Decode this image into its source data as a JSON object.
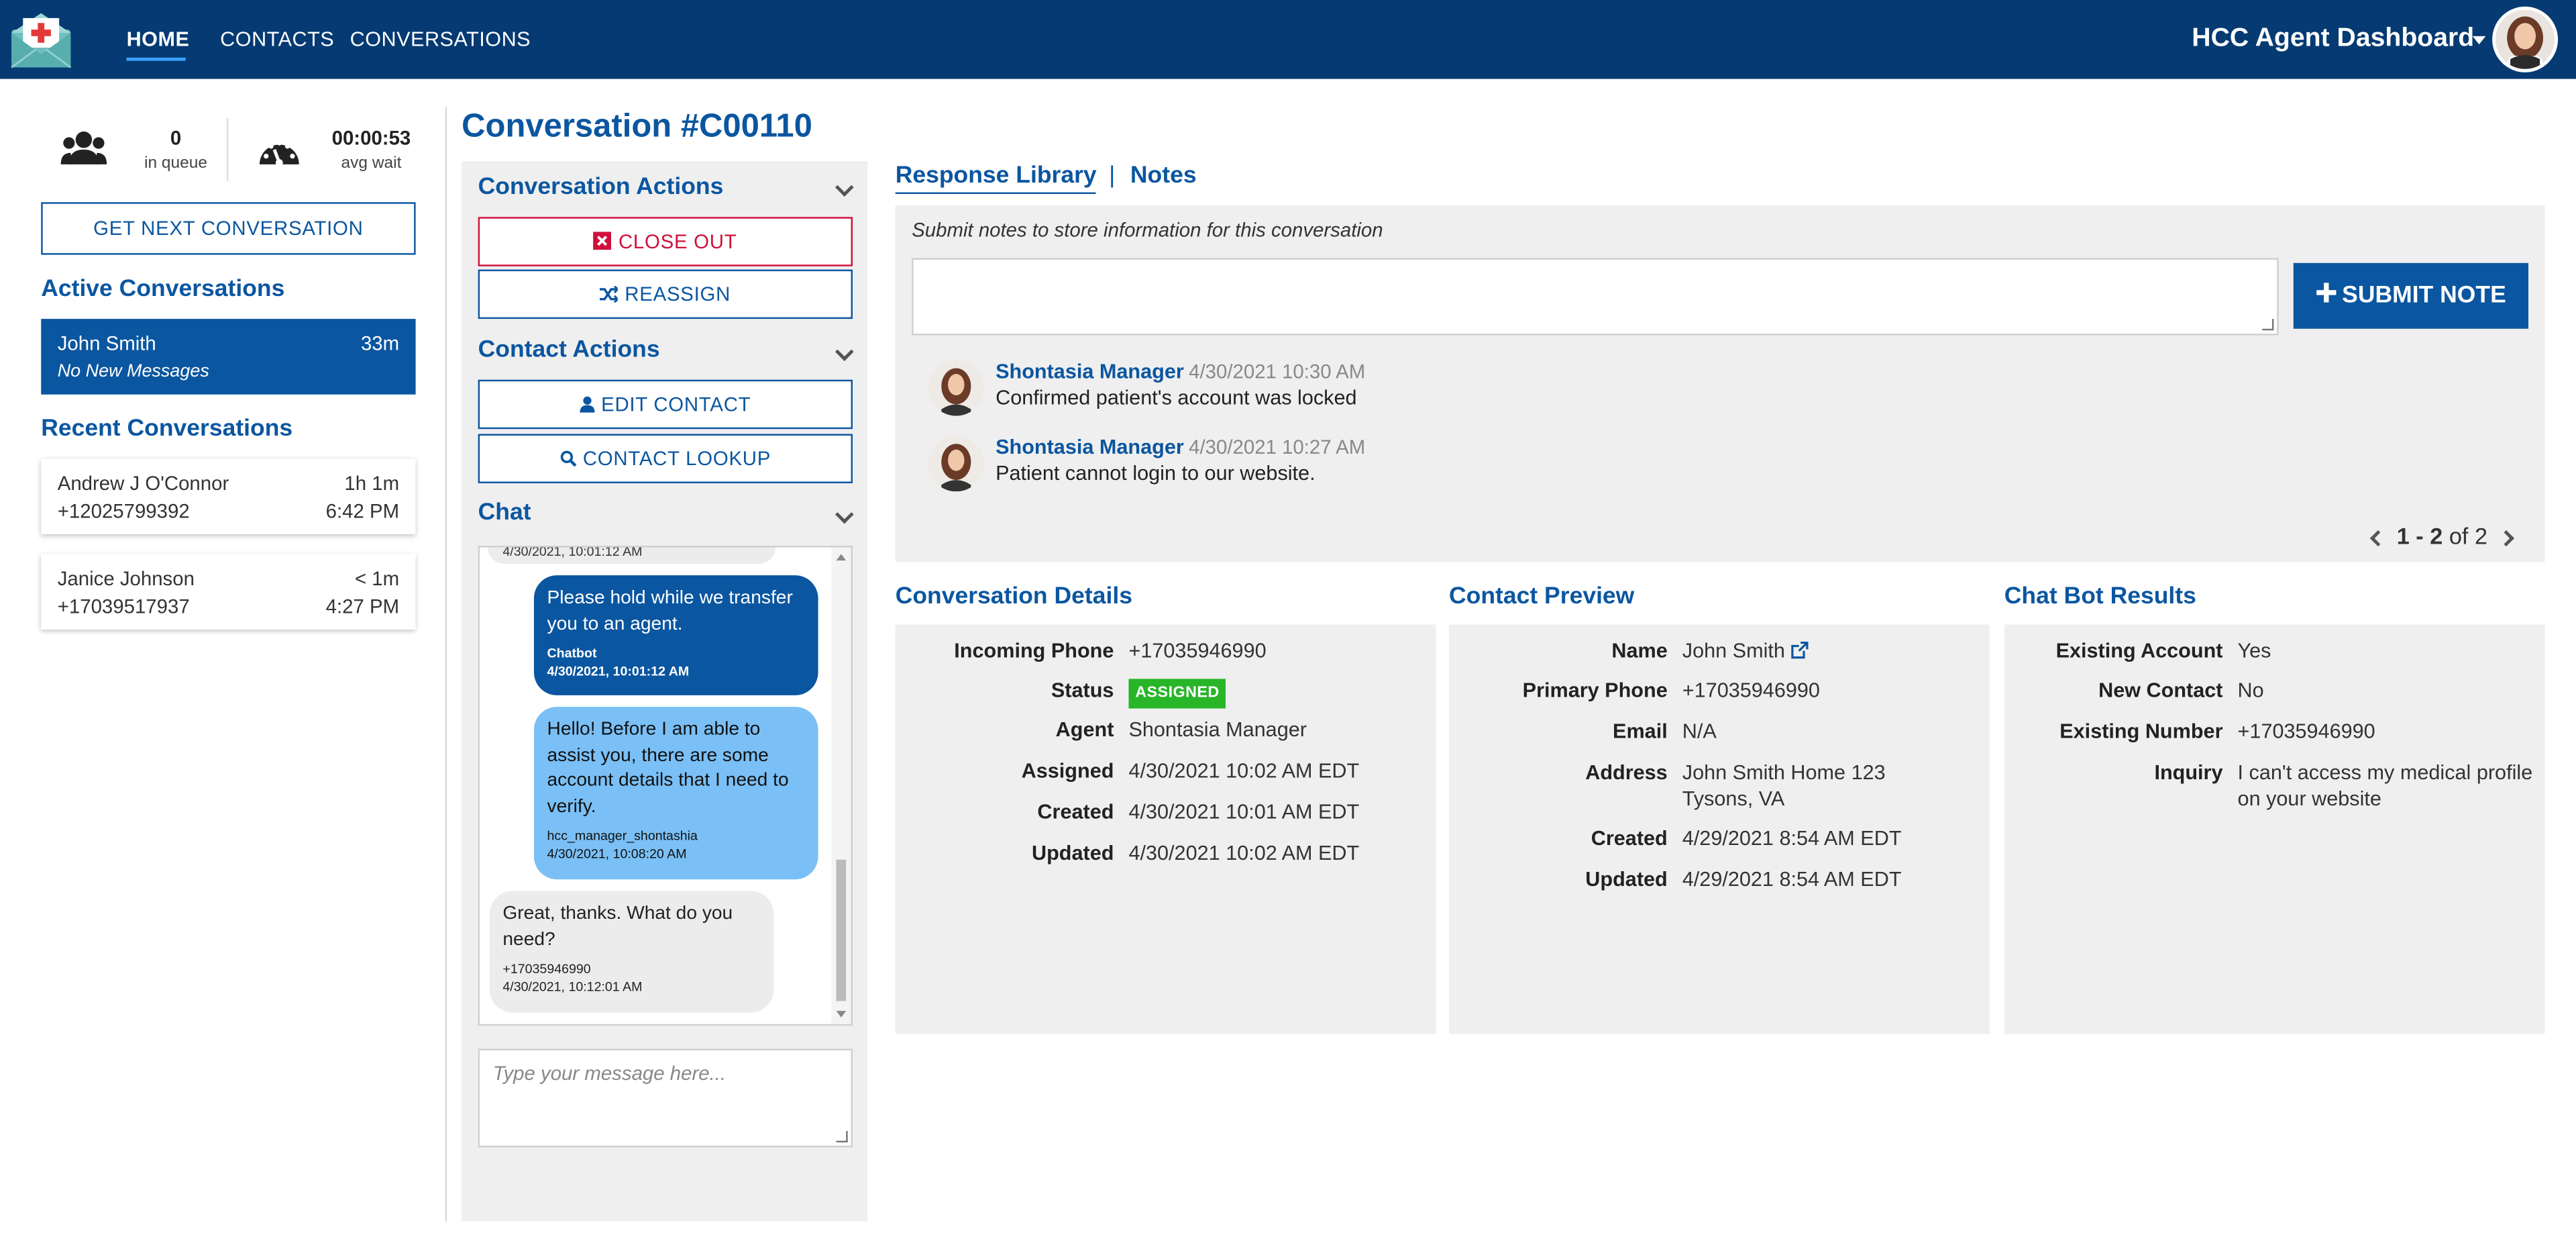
{
  "nav": {
    "links": [
      "HOME",
      "CONTACTS",
      "CONVERSATIONS"
    ],
    "dashboard_title": "HCC Agent Dashboard"
  },
  "stats": {
    "queue_value": "0",
    "queue_label": "in queue",
    "wait_value": "00:00:53",
    "wait_label": "avg wait"
  },
  "left": {
    "next_button": "GET NEXT CONVERSATION",
    "active_heading": "Active Conversations",
    "active": {
      "name": "John Smith",
      "time": "33m",
      "sub": "No New Messages"
    },
    "recent_heading": "Recent Conversations",
    "recent": [
      {
        "name": "Andrew J O'Connor",
        "duration": "1h 1m",
        "phone": "+12025799392",
        "time": "6:42 PM"
      },
      {
        "name": "Janice Johnson",
        "duration": "< 1m",
        "phone": "+17039517937",
        "time": "4:27 PM"
      }
    ]
  },
  "conversation": {
    "title": "Conversation #C00110"
  },
  "actions": {
    "conv_heading": "Conversation Actions",
    "close_out": "CLOSE OUT",
    "reassign": "REASSIGN",
    "contact_heading": "Contact Actions",
    "edit_contact": "EDIT CONTACT",
    "contact_lookup": "CONTACT LOOKUP",
    "chat_heading": "Chat",
    "chat_input_placeholder": "Type your message here..."
  },
  "chat": {
    "cut_meta": "4/30/2021, 10:01:12 AM",
    "messages": [
      {
        "text": "Please hold while we transfer you to an agent.",
        "sender": "Chatbot",
        "time": "4/30/2021, 10:01:12 AM"
      },
      {
        "text": "Hello! Before I am able to assist you, there are some account details that I need to verify.",
        "sender": "hcc_manager_shontashia",
        "time": "4/30/2021, 10:08:20 AM"
      },
      {
        "text": "Great, thanks. What do you need?",
        "sender": "+17035946990",
        "time": "4/30/2021, 10:12:01 AM"
      }
    ]
  },
  "notes": {
    "tab_response": "Response Library",
    "tab_sep": "|",
    "tab_notes": "Notes",
    "help": "Submit notes to store information for this conversation",
    "submit": "SUBMIT NOTE",
    "items": [
      {
        "author": "Shontasia Manager",
        "time": "4/30/2021 10:30 AM",
        "text": "Confirmed patient's account was locked"
      },
      {
        "author": "Shontasia Manager",
        "time": "4/30/2021 10:27 AM",
        "text": "Patient cannot login to our website."
      }
    ],
    "pager_range": "1 - 2",
    "pager_of": "of 2"
  },
  "details": {
    "heading": "Conversation Details",
    "rows": [
      {
        "label": "Incoming Phone",
        "value": "+17035946990"
      },
      {
        "label": "Status",
        "value": "ASSIGNED"
      },
      {
        "label": "Agent",
        "value": "Shontasia Manager"
      },
      {
        "label": "Assigned",
        "value": "4/30/2021 10:02 AM EDT"
      },
      {
        "label": "Created",
        "value": "4/30/2021 10:01 AM EDT"
      },
      {
        "label": "Updated",
        "value": "4/30/2021 10:02 AM EDT"
      }
    ]
  },
  "contact": {
    "heading": "Contact Preview",
    "rows": [
      {
        "label": "Name",
        "value": "John Smith"
      },
      {
        "label": "Primary Phone",
        "value": "+17035946990"
      },
      {
        "label": "Email",
        "value": "N/A"
      },
      {
        "label": "Address",
        "value": "John Smith Home 123",
        "value2": "Tysons, VA"
      },
      {
        "label": "Created",
        "value": "4/29/2021 8:54 AM EDT"
      },
      {
        "label": "Updated",
        "value": "4/29/2021 8:54 AM EDT"
      }
    ]
  },
  "bot": {
    "heading": "Chat Bot Results",
    "rows": [
      {
        "label": "Existing Account",
        "value": "Yes"
      },
      {
        "label": "New Contact",
        "value": "No"
      },
      {
        "label": "Existing Number",
        "value": "+17035946990"
      },
      {
        "label": "Inquiry",
        "value": "I can't access my medical profile on your website"
      }
    ]
  },
  "colors": {
    "nav_bg": "#053a72",
    "primary": "#0b56a0",
    "danger": "#d0103a",
    "success": "#28b528",
    "bubble_light": "#7ac0f6",
    "panel_bg": "#efefef"
  }
}
